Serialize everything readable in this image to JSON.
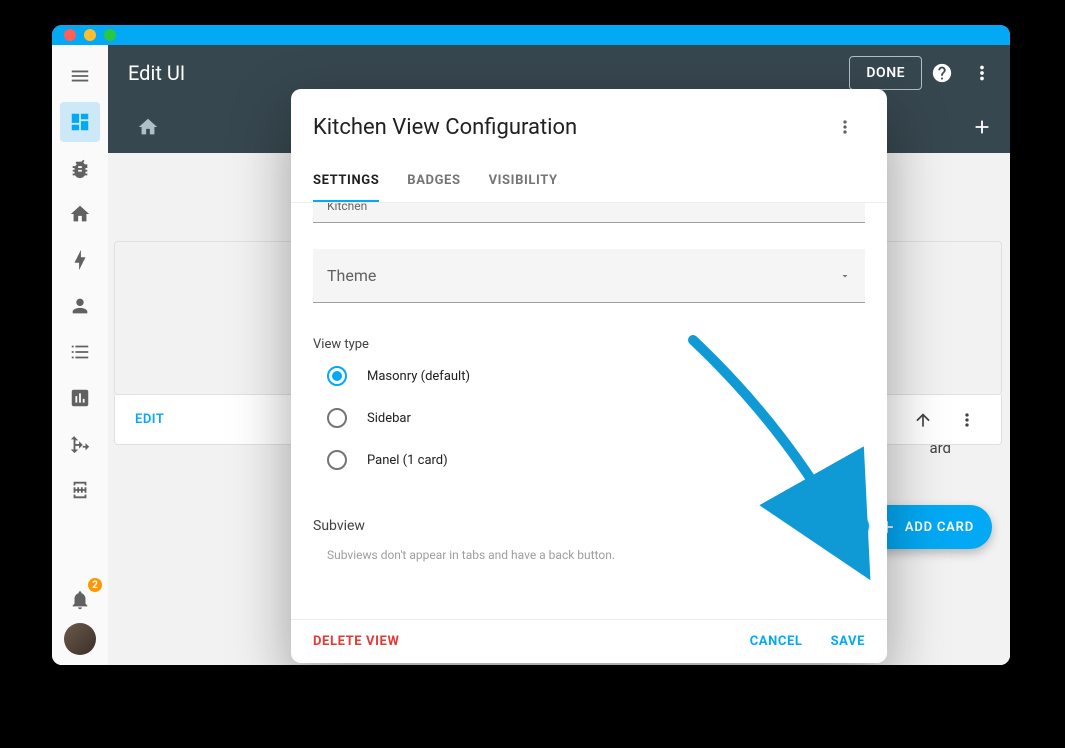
{
  "window": {
    "header_title": "Edit UI",
    "done_label": "DONE",
    "notification_count": "2"
  },
  "content": {
    "edit_label": "EDIT",
    "ghost_text": "ard",
    "fab_label": "ADD CARD"
  },
  "dialog": {
    "title": "Kitchen View Configuration",
    "tabs": {
      "settings": "SETTINGS",
      "badges": "BADGES",
      "visibility": "VISIBILITY"
    },
    "name_value": "Kitchen",
    "theme_label": "Theme",
    "view_type_label": "View type",
    "options": {
      "masonry": "Masonry (default)",
      "sidebar": "Sidebar",
      "panel": "Panel (1 card)"
    },
    "subview_label": "Subview",
    "subview_help": "Subviews don't appear in tabs and have a back button.",
    "delete_label": "DELETE VIEW",
    "cancel_label": "CANCEL",
    "save_label": "SAVE"
  }
}
